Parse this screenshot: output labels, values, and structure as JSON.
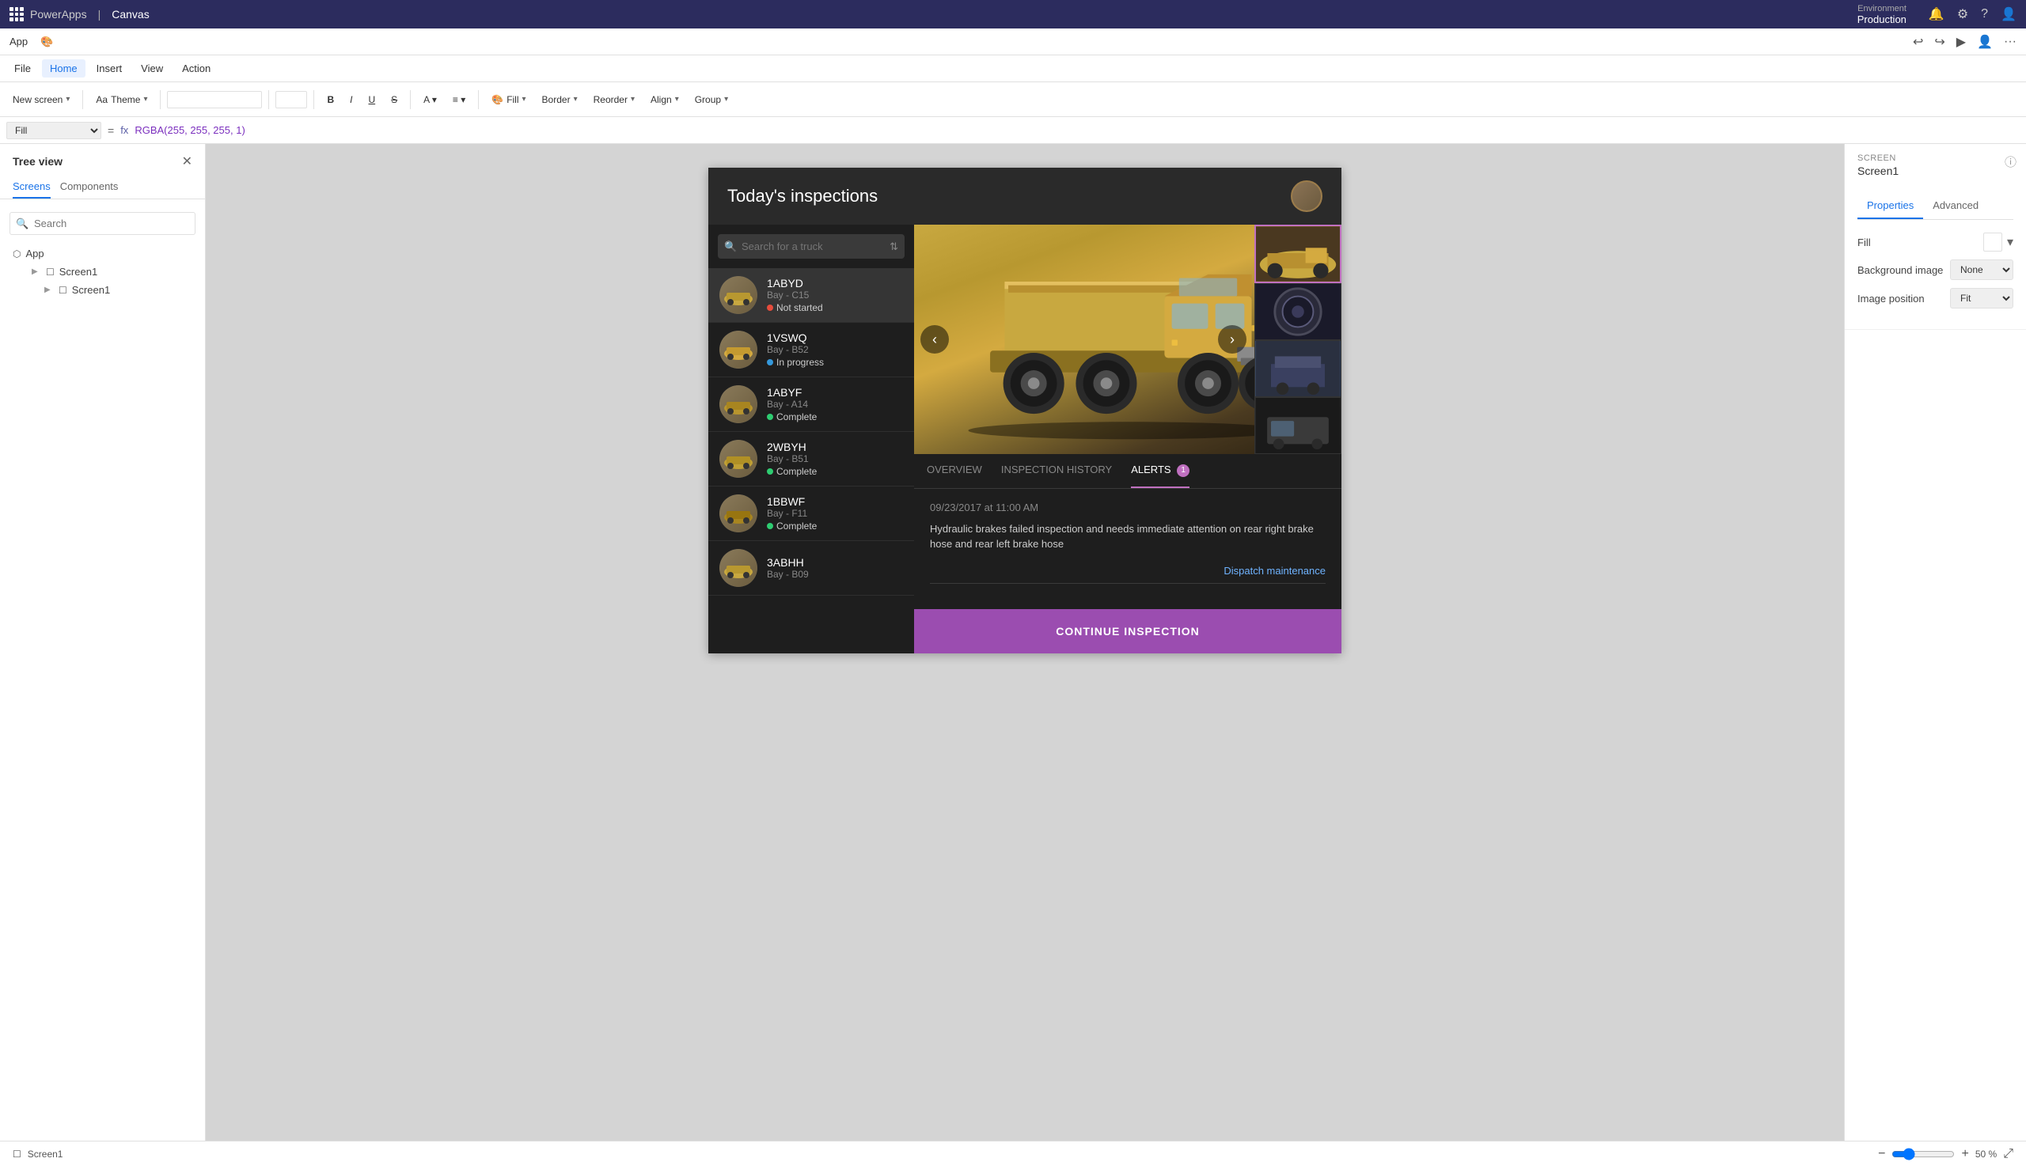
{
  "app": {
    "name": "PowerApps",
    "canvas_label": "Canvas"
  },
  "env": {
    "label": "Environment",
    "name": "Production"
  },
  "topbar": {
    "icons": [
      "bell",
      "gear",
      "help",
      "user",
      "expand"
    ]
  },
  "menubar": {
    "items": [
      "File",
      "Home",
      "Insert",
      "View",
      "Action"
    ],
    "active": "Home"
  },
  "toolbar": {
    "new_screen_label": "New screen",
    "theme_label": "Theme",
    "bold_label": "B",
    "italic_label": "I",
    "underline_label": "U",
    "fill_label": "Fill",
    "border_label": "Border",
    "reorder_label": "Reorder",
    "align_label": "Align",
    "group_label": "Group"
  },
  "formulabar": {
    "property_label": "Fill",
    "formula": "RGBA(255, 255, 255, 1)"
  },
  "sidebar": {
    "title": "Tree view",
    "tabs": [
      "Screens",
      "Components"
    ],
    "search_placeholder": "Search",
    "items": [
      {
        "label": "App",
        "type": "app"
      },
      {
        "label": "Screen1",
        "type": "screen",
        "level": 1
      },
      {
        "label": "Screen1",
        "type": "screen",
        "level": 2
      }
    ]
  },
  "canvas_app": {
    "header": {
      "title": "Today's inspections",
      "avatar_alt": "User avatar"
    },
    "search": {
      "placeholder": "Search for a truck",
      "filter_icon": "⇅"
    },
    "trucks": [
      {
        "id": "1ABYD",
        "bay": "Bay - C15",
        "status": "Not started",
        "status_color": "red"
      },
      {
        "id": "1VSWQ",
        "bay": "Bay - B52",
        "status": "In progress",
        "status_color": "blue"
      },
      {
        "id": "1ABYF",
        "bay": "Bay - A14",
        "status": "Complete",
        "status_color": "green"
      },
      {
        "id": "2WBYH",
        "bay": "Bay - B51",
        "status": "Complete",
        "status_color": "green"
      },
      {
        "id": "1BBWF",
        "bay": "Bay - F11",
        "status": "Complete",
        "status_color": "green"
      },
      {
        "id": "3ABHH",
        "bay": "Bay - B09",
        "status": "",
        "status_color": ""
      }
    ],
    "detail": {
      "tabs": [
        {
          "label": "OVERVIEW",
          "badge": null
        },
        {
          "label": "INSPECTION HISTORY",
          "badge": null
        },
        {
          "label": "ALERTS",
          "badge": "1"
        }
      ],
      "active_tab": "ALERTS",
      "alert_date": "09/23/2017 at 11:00 AM",
      "alert_text": "Hydraulic brakes failed inspection and needs immediate attention on rear right brake hose and rear left brake hose",
      "dispatch_label": "Dispatch maintenance",
      "continue_label": "CONTINUE INSPECTION",
      "nav_prev": "‹",
      "nav_next": "›"
    }
  },
  "right_panel": {
    "screen_section_label": "SCREEN",
    "screen_name": "Screen1",
    "tabs": [
      "Properties",
      "Advanced"
    ],
    "active_tab": "Properties",
    "rows": [
      {
        "label": "Fill",
        "value": "",
        "has_color_picker": true
      },
      {
        "label": "Background image",
        "value": "None"
      },
      {
        "label": "Image position",
        "value": "Fit"
      }
    ]
  },
  "statusbar": {
    "screen_label": "Screen1",
    "zoom_minus": "−",
    "zoom_plus": "+",
    "zoom_value": "50 %",
    "expand_icon": "⤢"
  }
}
